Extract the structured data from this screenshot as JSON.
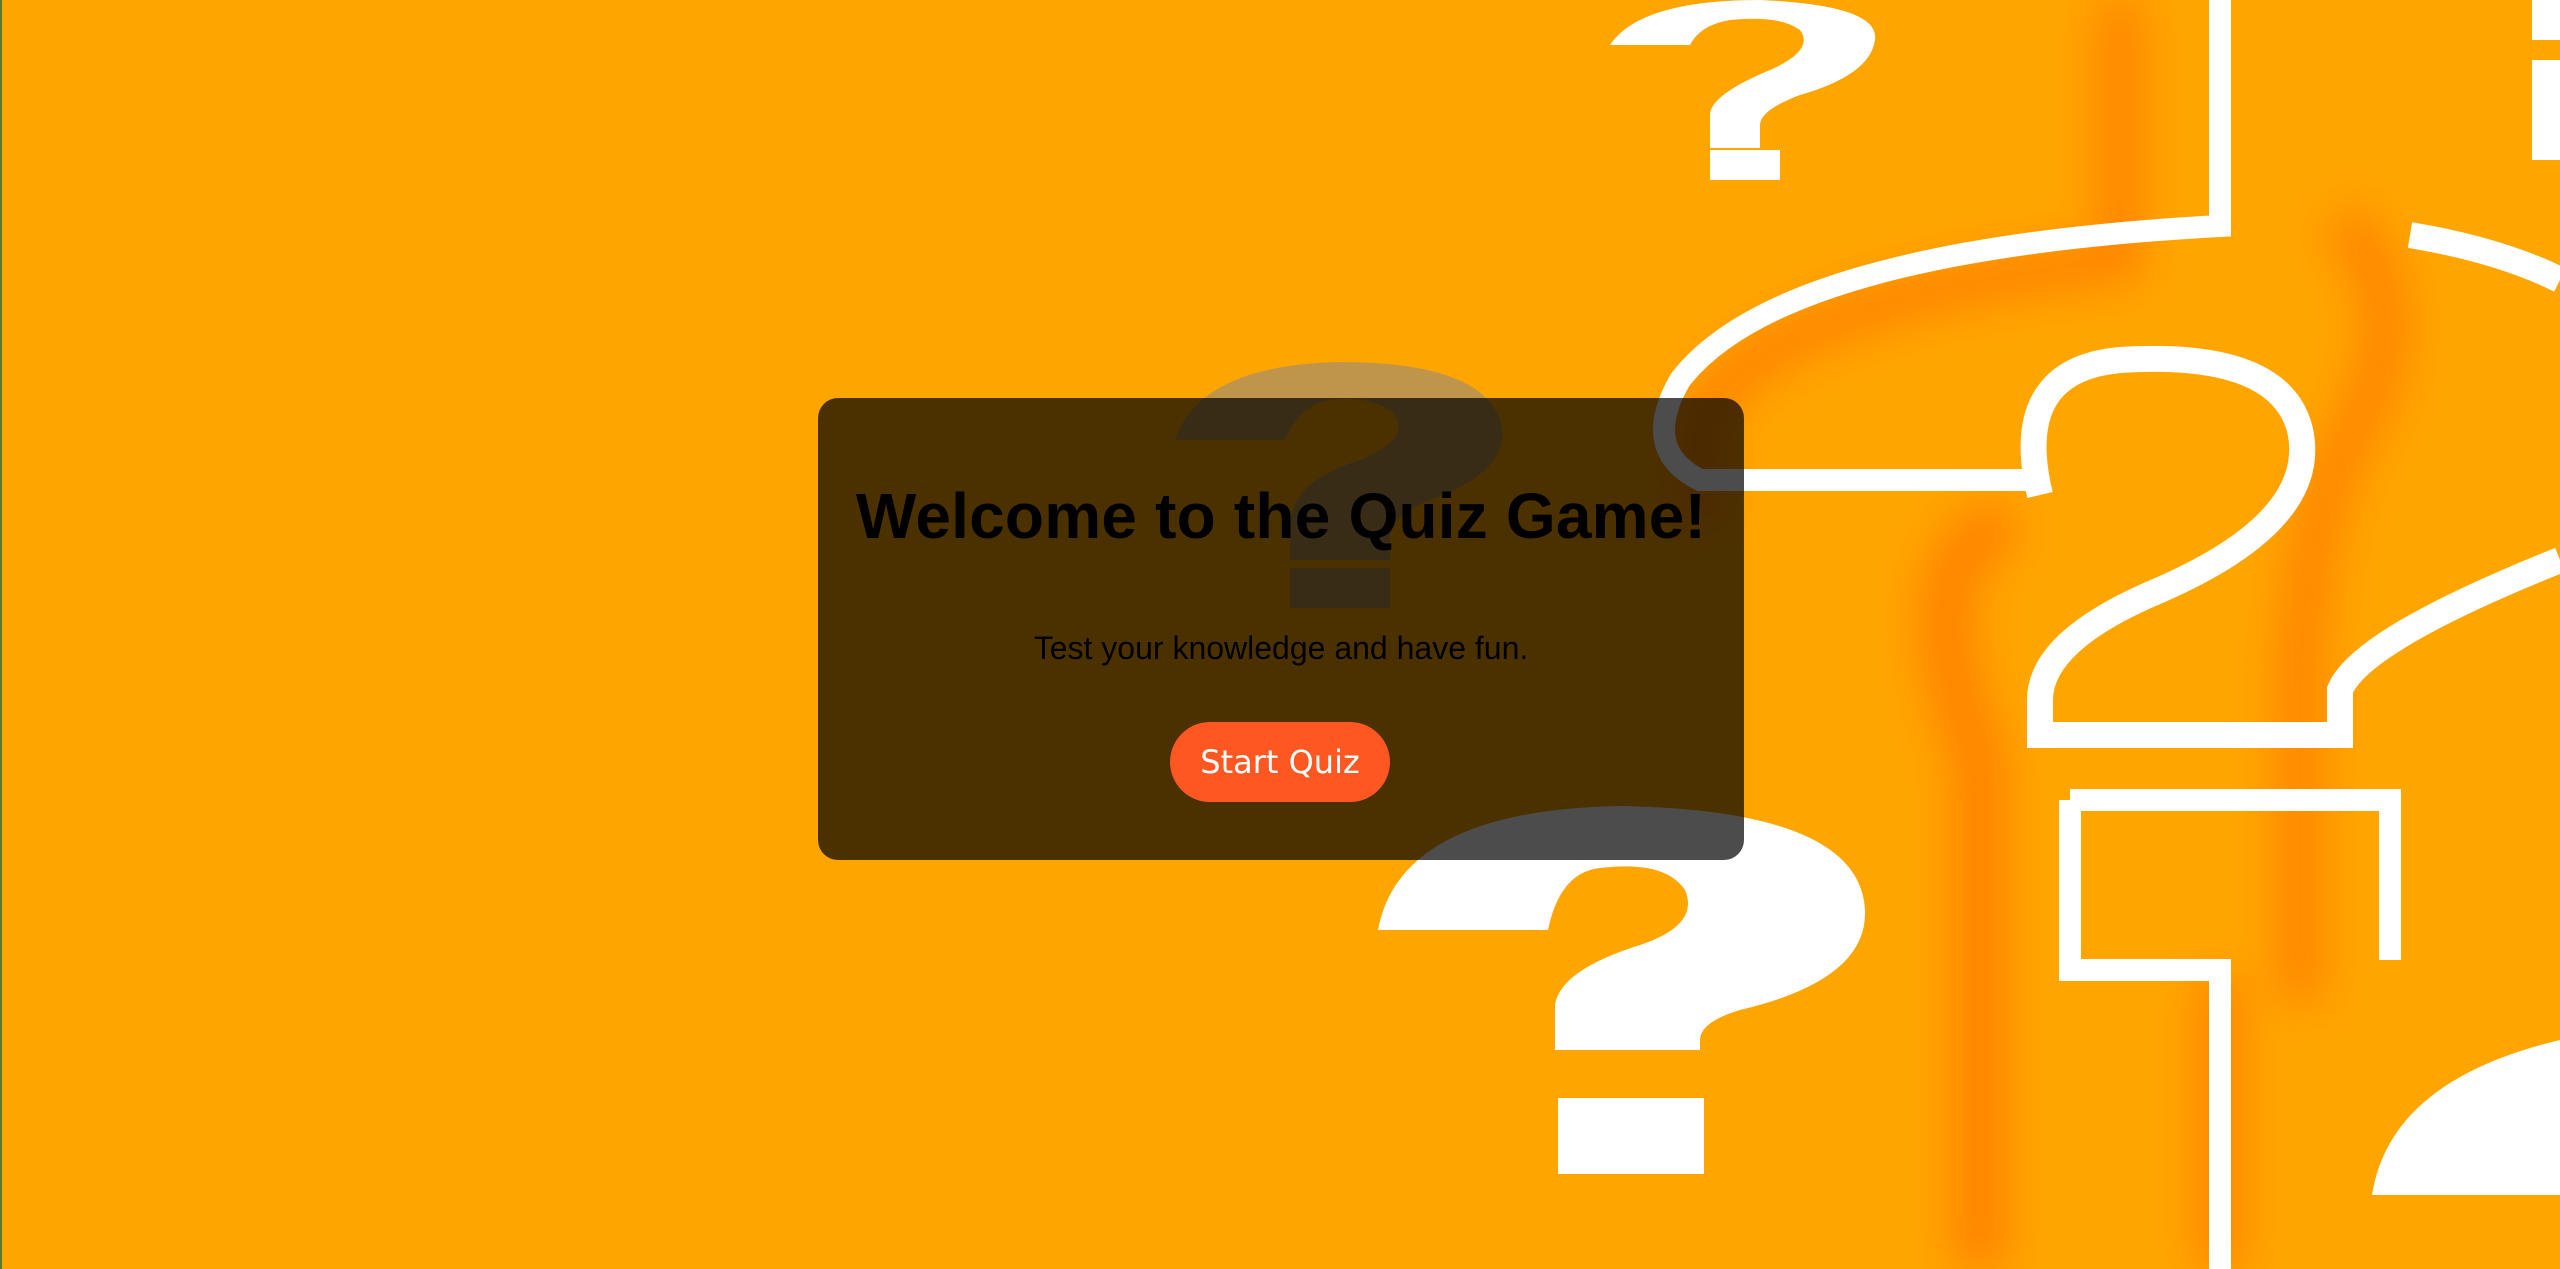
{
  "page": {
    "background_color": "#FFA500",
    "background_art_icon": "question-mark-pattern"
  },
  "card": {
    "title": "Welcome to the Quiz Game!",
    "subtitle": "Test your knowledge and have fun.",
    "start_button_label": "Start Quiz",
    "button_color": "#FF5722"
  }
}
